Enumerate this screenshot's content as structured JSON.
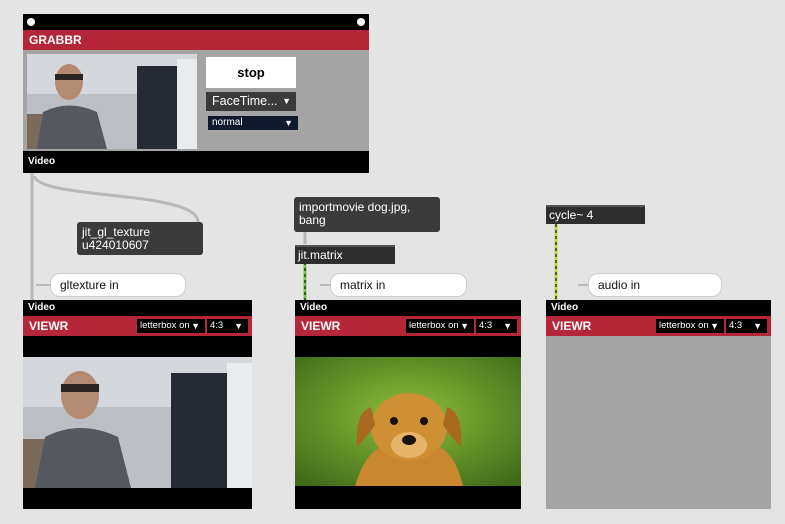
{
  "grabbr": {
    "title": "GRABBR",
    "stop_label": "stop",
    "device_select": "FaceTime...",
    "mode_select": "normal",
    "footer": "Video"
  },
  "messages": {
    "texture": "jit_gl_texture u424010607",
    "importmovie": "importmovie dog.jpg, bang"
  },
  "objects": {
    "jit_matrix": "jit.matrix",
    "cycle": "cycle~ 4"
  },
  "comments": {
    "gltexture_in": "gltexture in",
    "matrix_in": "matrix in",
    "audio_in": "audio in"
  },
  "viewers": [
    {
      "header": "Video",
      "title": "VIEWR",
      "letterbox": "letterbox on",
      "aspect": "4:3"
    },
    {
      "header": "Video",
      "title": "VIEWR",
      "letterbox": "letterbox on",
      "aspect": "4:3"
    },
    {
      "header": "Video",
      "title": "VIEWR",
      "letterbox": "letterbox on",
      "aspect": "4:3"
    }
  ],
  "colors": {
    "accent_red": "#b52738",
    "canvas": "#e4e4e4",
    "panel_gray": "#a4a4a4",
    "signal_cord": "#55a032"
  }
}
